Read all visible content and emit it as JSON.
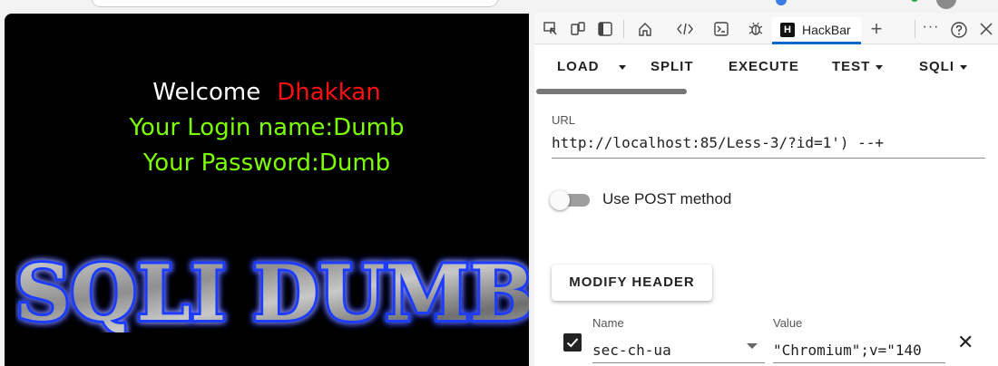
{
  "page": {
    "welcome_label": "Welcome",
    "welcome_name": "Dhakkan",
    "login_line": "Your Login name:Dumb",
    "password_line": "Your Password:Dumb",
    "banner_text": "SQLI DUMB"
  },
  "devtools": {
    "tab_label": "HackBar",
    "toolbar": {
      "load": "LOAD",
      "split": "SPLIT",
      "execute": "EXECUTE",
      "test": "TEST",
      "sqli": "SQLI"
    },
    "url": {
      "label": "URL",
      "value": "http://localhost:85/Less-3/?id=1') --+"
    },
    "post_method": {
      "label": "Use POST method",
      "enabled": false
    },
    "modify_header_label": "MODIFY HEADER",
    "header_row": {
      "checked": true,
      "name_label": "Name",
      "name_value": "sec-ch-ua",
      "value_label": "Value",
      "value_value": "\"Chromium\";v=\"140"
    }
  },
  "icons": [
    "inspect-icon",
    "device-emulation-icon",
    "dock-side-icon",
    "welcome-home-icon",
    "elements-icon",
    "console-icon",
    "sources-debug-icon",
    "new-tab-plus-icon",
    "more-options-icon",
    "help-icon",
    "close-icon"
  ],
  "colors": {
    "welcome_text": "#ffffff",
    "name_red": "#ff1010",
    "login_green": "#7cff00",
    "tab_underline": "#0a68c8"
  }
}
